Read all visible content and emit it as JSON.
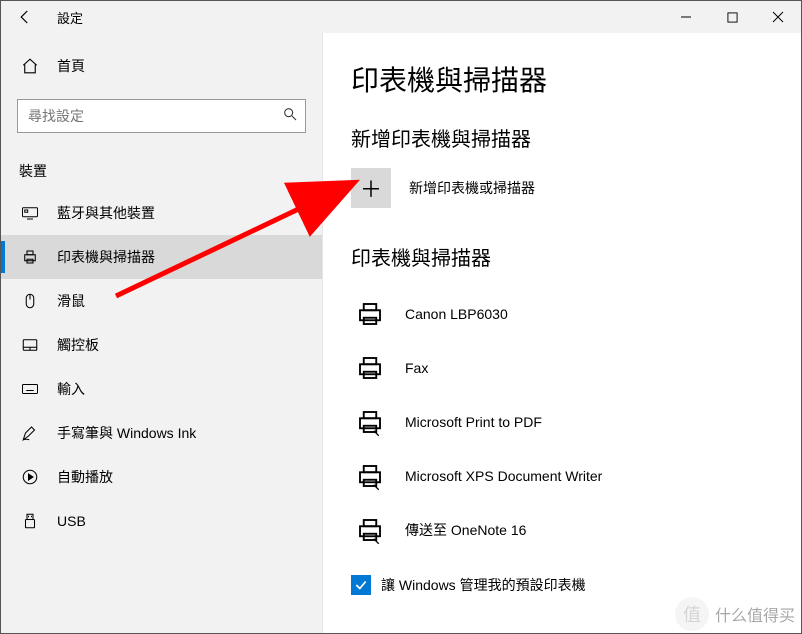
{
  "titlebar": {
    "title": "設定"
  },
  "sidebar": {
    "home": "首頁",
    "search_placeholder": "尋找設定",
    "category": "裝置",
    "items": [
      {
        "label": "藍牙與其他裝置"
      },
      {
        "label": "印表機與掃描器"
      },
      {
        "label": "滑鼠"
      },
      {
        "label": "觸控板"
      },
      {
        "label": "輸入"
      },
      {
        "label": "手寫筆與 Windows Ink"
      },
      {
        "label": "自動播放"
      },
      {
        "label": "USB"
      }
    ]
  },
  "content": {
    "page_title": "印表機與掃描器",
    "add_section_title": "新增印表機與掃描器",
    "add_label": "新增印表機或掃描器",
    "list_section_title": "印表機與掃描器",
    "printers": [
      {
        "name": "Canon LBP6030"
      },
      {
        "name": "Fax"
      },
      {
        "name": "Microsoft Print to PDF"
      },
      {
        "name": "Microsoft XPS Document Writer"
      },
      {
        "name": "傳送至 OneNote 16"
      }
    ],
    "manage_default_label": "讓 Windows 管理我的預設印表機"
  },
  "watermark": {
    "text": "什么值得买"
  }
}
